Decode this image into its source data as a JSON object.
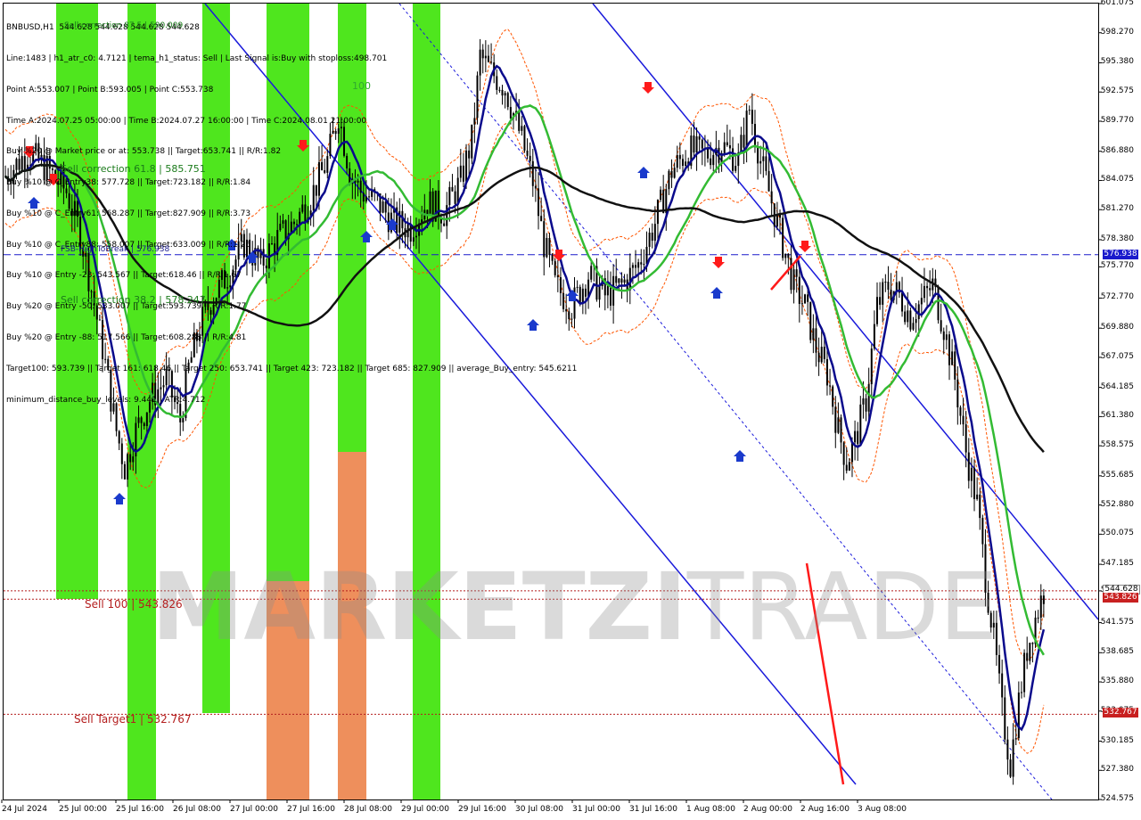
{
  "window": {
    "symbol_line": "BNBUSD,H1  544.628 544.628 544.628 544.628"
  },
  "info_lines": [
    "Line:1483 | h1_atr_c0: 4.7121 | tema_h1_status: Sell | Last Signal is:Buy with stoploss:498.701",
    "Point A:553.007 | Point B:593.005 | Point C:553.738",
    "Time A:2024.07.25 05:00:00 | Time B:2024.07.27 16:00:00 | Time C:2024.08.01 21:00:00",
    "Buy %20 @ Market price or at: 553.738 || Target:653.741 || R/R:1.82",
    "Buy %10 @ C_Entry38: 577.728 || Target:723.182 || R/R:1.84",
    "Buy %10 @ C_Entry61: 568.287 || Target:827.909 || R/R:3.73",
    "Buy %10 @ C_Entry88: 558.007 || Target:633.009 || R/R:1.26",
    "Buy %10 @ Entry -23: 543.567 || Target:618.46 || R/R:1.67",
    "Buy %20 @ Entry -50: 533.007 || Target:593.739 || R/R:1.77",
    "Buy %20 @ Entry -88: 517.566 || Target:608.288 || R/R:4.81",
    "Target100: 593.739 || Target 161: 618.46 || Target 250: 653.741 || Target 423: 723.182 || Target 685: 827.909 || average_Buy_entry: 545.6211",
    "minimum_distance_buy_levels: 9.441 | ATR:4.712"
  ],
  "overlay_labels": {
    "sell_correction_618": "Sell correction 61.8 | 585.751",
    "sell_correction_382": "Sell correction 38.2 | 578.247",
    "fsb_high_to_break": "FSB-HighToBreak | 576.938",
    "sell_100": "Sell 100 | 543.826",
    "sell_target1": "Sell Target1 | 532.767",
    "zone_100": "100",
    "top_sell_correction": "Sell correction 87.5 | 590.009"
  },
  "watermark": {
    "bold": "MARKETZI",
    "thin": "TRADE"
  },
  "price_axis": {
    "ticks": [
      "601.075",
      "598.270",
      "595.380",
      "592.575",
      "589.770",
      "586.880",
      "584.075",
      "581.270",
      "578.380",
      "575.770",
      "572.770",
      "569.880",
      "567.075",
      "564.185",
      "561.380",
      "558.575",
      "555.685",
      "552.880",
      "550.075",
      "547.185",
      "544.628",
      "541.575",
      "538.685",
      "535.880",
      "533.075",
      "530.185",
      "527.380",
      "524.575"
    ],
    "current_price_tag": "544.628",
    "sell100_tag": "543.826",
    "fsb_tag": "576.938",
    "target1_tag": "532.767"
  },
  "time_axis": {
    "ticks": [
      "24 Jul 2024",
      "25 Jul 00:00",
      "25 Jul 16:00",
      "26 Jul 08:00",
      "27 Jul 00:00",
      "27 Jul 16:00",
      "28 Jul 08:00",
      "29 Jul 00:00",
      "29 Jul 16:00",
      "30 Jul 08:00",
      "31 Jul 00:00",
      "31 Jul 16:00",
      "1 Aug 08:00",
      "2 Aug 00:00",
      "2 Aug 16:00",
      "3 Aug 08:00"
    ]
  },
  "colors": {
    "bull_zone": "#4fe61e",
    "bear_zone": "#ee8f5c",
    "candle": "#000000",
    "channel": "#1a1adb",
    "ma_fast": "#0a0a8c",
    "ma_mid": "#33bb33",
    "ma_slow": "#111111",
    "sell_level": "#b41e1e",
    "fsb_line": "#1a1acc",
    "envelope": "#ff5500"
  },
  "chart_data": {
    "type": "candlestick",
    "symbol": "BNBUSD",
    "timeframe": "H1",
    "ylim": [
      524.575,
      601.075
    ],
    "last_price": 544.628,
    "levels": [
      {
        "name": "FSB-HighToBreak",
        "value": 576.938
      },
      {
        "name": "Sell 100",
        "value": 543.826
      },
      {
        "name": "Sell Target1",
        "value": 532.767
      },
      {
        "name": "Sell correction 61.8",
        "value": 585.751
      },
      {
        "name": "Sell correction 38.2",
        "value": 578.247
      }
    ],
    "close_path": [
      [
        0,
        584.5
      ],
      [
        8,
        586.8
      ],
      [
        15,
        585.2
      ],
      [
        22,
        583.0
      ],
      [
        27,
        579.0
      ],
      [
        30,
        575.0
      ],
      [
        35,
        568.0
      ],
      [
        40,
        560.0
      ],
      [
        43,
        556.5
      ],
      [
        47,
        560.0
      ],
      [
        52,
        563.0
      ],
      [
        58,
        565.0
      ],
      [
        63,
        561.0
      ],
      [
        66,
        566.0
      ],
      [
        70,
        570.0
      ],
      [
        74,
        572.5
      ],
      [
        80,
        575.0
      ],
      [
        86,
        578.0
      ],
      [
        92,
        576.0
      ],
      [
        98,
        578.5
      ],
      [
        104,
        580.0
      ],
      [
        110,
        582.5
      ],
      [
        116,
        586.0
      ],
      [
        120,
        590.5
      ],
      [
        124,
        585.0
      ],
      [
        128,
        583.0
      ],
      [
        134,
        582.0
      ],
      [
        140,
        580.0
      ],
      [
        146,
        579.5
      ],
      [
        152,
        582.0
      ],
      [
        158,
        581.0
      ],
      [
        164,
        584.0
      ],
      [
        168,
        588.0
      ],
      [
        171,
        596.0
      ],
      [
        175,
        594.5
      ],
      [
        180,
        593.0
      ],
      [
        186,
        588.0
      ],
      [
        190,
        584.0
      ],
      [
        194,
        578.0
      ],
      [
        198,
        574.0
      ],
      [
        204,
        572.0
      ],
      [
        210,
        575.0
      ],
      [
        216,
        573.0
      ],
      [
        222,
        574.0
      ],
      [
        228,
        576.0
      ],
      [
        234,
        580.0
      ],
      [
        240,
        585.0
      ],
      [
        246,
        587.0
      ],
      [
        252,
        586.5
      ],
      [
        258,
        587.5
      ],
      [
        264,
        586.0
      ],
      [
        268,
        591.0
      ],
      [
        272,
        586.0
      ],
      [
        276,
        582.0
      ],
      [
        280,
        578.0
      ],
      [
        284,
        574.0
      ],
      [
        288,
        572.0
      ],
      [
        292,
        568.0
      ],
      [
        296,
        565.5
      ],
      [
        300,
        560.0
      ],
      [
        303,
        557.0
      ],
      [
        306,
        559.0
      ],
      [
        310,
        563.0
      ],
      [
        314,
        572.0
      ],
      [
        318,
        574.0
      ],
      [
        322,
        573.0
      ],
      [
        326,
        571.0
      ],
      [
        330,
        572.5
      ],
      [
        334,
        574.0
      ],
      [
        338,
        570.0
      ],
      [
        342,
        565.0
      ],
      [
        346,
        558.0
      ],
      [
        350,
        553.0
      ],
      [
        353,
        546.0
      ],
      [
        356,
        540.0
      ],
      [
        359,
        533.0
      ],
      [
        362,
        528.0
      ],
      [
        365,
        534.0
      ],
      [
        368,
        539.0
      ],
      [
        371,
        542.0
      ],
      [
        374,
        544.6
      ]
    ]
  }
}
